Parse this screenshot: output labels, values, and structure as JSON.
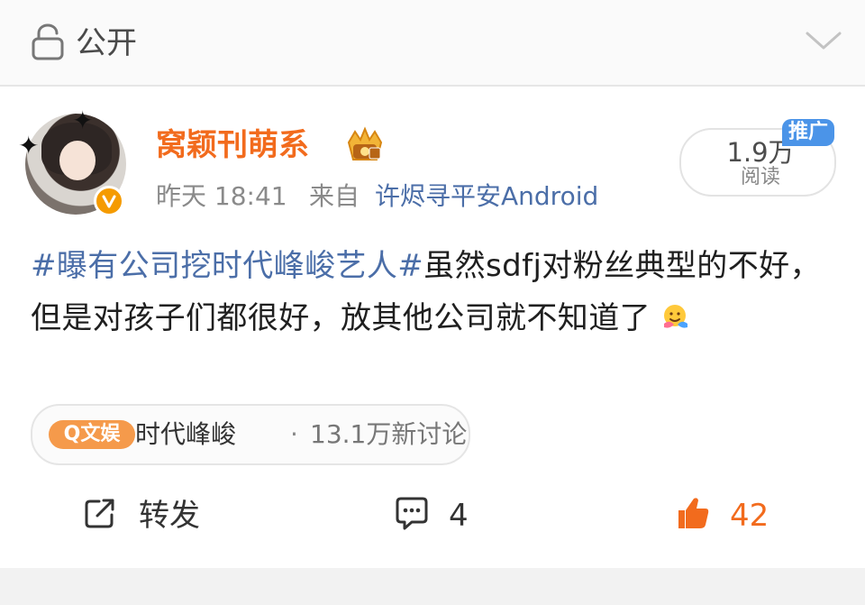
{
  "privacy": {
    "label": "公开"
  },
  "post": {
    "author": "窝颖刊萌系",
    "time": "昨天 18:41",
    "source_label": "来自",
    "source_app": "许烬寻平安Android",
    "reads": {
      "count": "1.9万",
      "label": "阅读",
      "tag": "推广"
    },
    "text": {
      "topic": "#曝有公司挖时代峰峻艺人#",
      "body": "虽然sdfj对粉丝典型的不好，但是对孩子们都很好，放其他公司就不知道了"
    },
    "topic_chip": {
      "badge": "Q文娱",
      "name": "时代峰峻",
      "separator": "·",
      "discussion": "13.1万新讨论"
    },
    "actions": {
      "repost_label": "转发",
      "comment_count": "4",
      "like_count": "42"
    }
  },
  "colors": {
    "accent_orange": "#f26b1d",
    "link_blue": "#4b6ea8",
    "promo_blue": "#4b94e8",
    "badge_orange": "#f59a4b"
  },
  "icons": {
    "privacy": "lock-icon",
    "expand": "chevron-down-icon",
    "verified": "verified-badge-icon",
    "vip": "crown-icon",
    "repost": "share-icon",
    "comment": "comment-icon",
    "like": "thumbs-up-icon",
    "emoji": "hugging-face-icon"
  }
}
